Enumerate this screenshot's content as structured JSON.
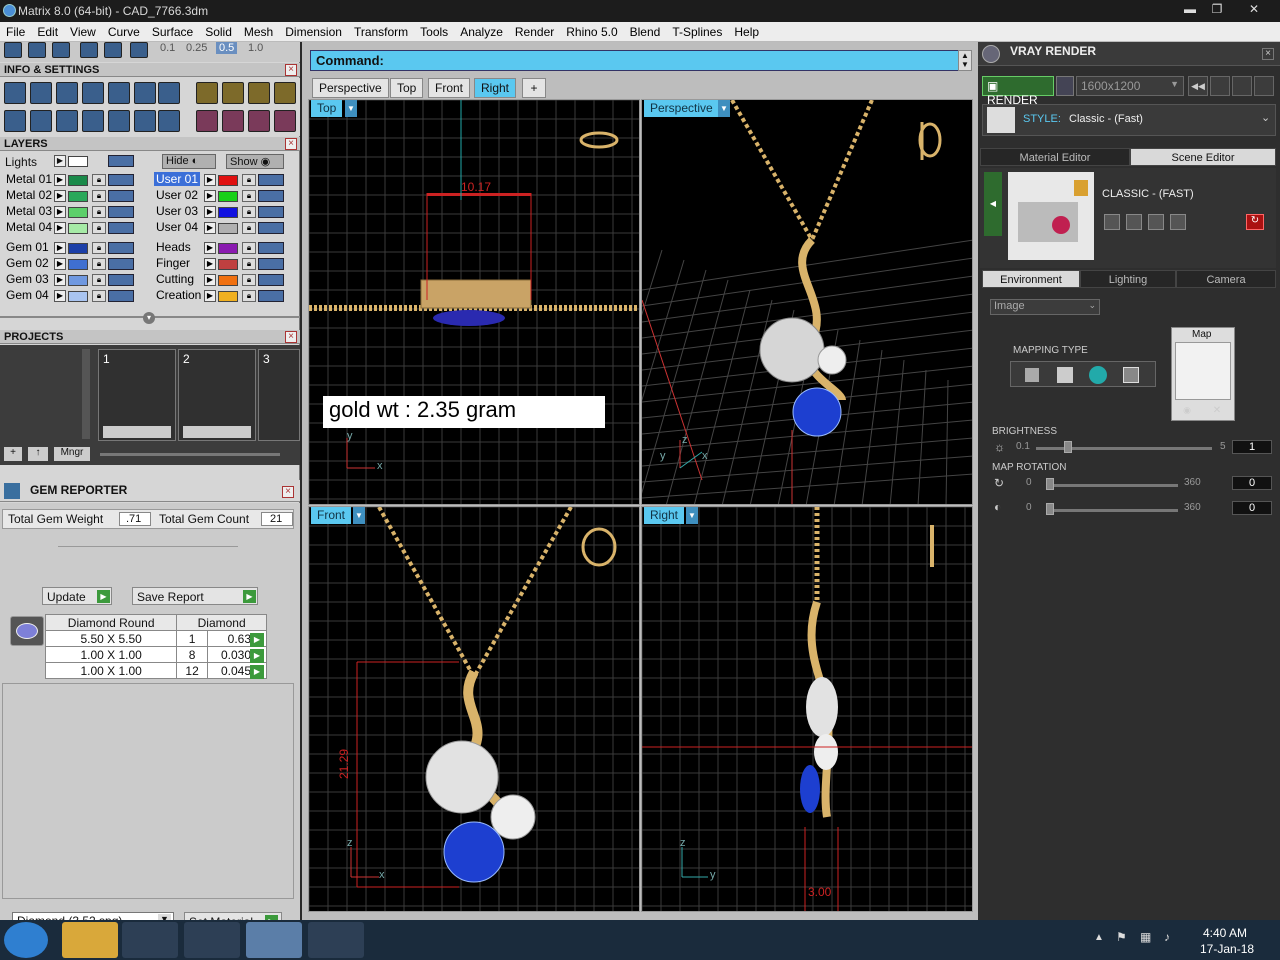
{
  "window": {
    "title": "Matrix 8.0 (64-bit) - CAD_7766.3dm",
    "min": "▬",
    "max": "❐",
    "close": "✕"
  },
  "menu": [
    "File",
    "Edit",
    "View",
    "Curve",
    "Surface",
    "Solid",
    "Mesh",
    "Dimension",
    "Transform",
    "Tools",
    "Analyze",
    "Render",
    "Rhino 5.0",
    "Blend",
    "T-Splines",
    "Help"
  ],
  "toolbar_top": {
    "values": [
      "0.1",
      "0.25",
      "0.5",
      "1.0"
    ]
  },
  "info_settings": {
    "title": "INFO & SETTINGS"
  },
  "layers": {
    "title": "LAYERS",
    "lights": "Lights",
    "hide": "Hide",
    "show": "Show",
    "left": [
      {
        "name": "Metal 01",
        "color": "#1a8a4a"
      },
      {
        "name": "Metal 02",
        "color": "#2aa85a"
      },
      {
        "name": "Metal 03",
        "color": "#5ccf6a"
      },
      {
        "name": "Metal 04",
        "color": "#a6eaa6"
      },
      {
        "name": "Gem 01",
        "color": "#1c3fa8"
      },
      {
        "name": "Gem 02",
        "color": "#3f6fd0"
      },
      {
        "name": "Gem 03",
        "color": "#6f98e0"
      },
      {
        "name": "Gem 04",
        "color": "#a9c4f0"
      }
    ],
    "right": [
      {
        "name": "User 01",
        "color": "#e01010"
      },
      {
        "name": "User 02",
        "color": "#18d018"
      },
      {
        "name": "User 03",
        "color": "#1010e0"
      },
      {
        "name": "User 04",
        "color": "#b0b0b0"
      },
      {
        "name": "Heads",
        "color": "#8a1ab0"
      },
      {
        "name": "Finger",
        "color": "#c04040"
      },
      {
        "name": "Cutting",
        "color": "#f07010"
      },
      {
        "name": "Creation",
        "color": "#f0b020"
      }
    ]
  },
  "projects": {
    "title": "PROJECTS",
    "slots": [
      "1",
      "2",
      "3"
    ],
    "mngr": "Mngr"
  },
  "gem_reporter": {
    "title": "GEM REPORTER",
    "total_weight_label": "Total Gem Weight",
    "total_weight": ".71",
    "total_count_label": "Total Gem Count",
    "total_count": "21",
    "update": "Update",
    "save_report": "Save Report",
    "headers": [
      "Diamond Round",
      "Diamond"
    ],
    "rows": [
      [
        "5.50 X 5.50",
        "1",
        "0.63tw"
      ],
      [
        "1.00 X 1.00",
        "8",
        "0.030tw"
      ],
      [
        "1.00 X 1.00",
        "12",
        "0.045tw"
      ]
    ],
    "material_select": "Diamond     (3.52 spg)",
    "set_material": "Set Material"
  },
  "command": {
    "label": "Command:"
  },
  "view_tabs": [
    "Perspective",
    "Top",
    "Front",
    "Right",
    "+"
  ],
  "active_view_tab": "Right",
  "viewports": {
    "top": {
      "label": "Top",
      "dim": "10.17",
      "note": "gold wt : 2.35 gram",
      "axes": [
        "y",
        "x"
      ]
    },
    "perspective": {
      "label": "Perspective",
      "axes": [
        "z",
        "y",
        "x"
      ]
    },
    "front": {
      "label": "Front",
      "dim": "21.29",
      "axes": [
        "z",
        "x"
      ]
    },
    "right": {
      "label": "Right",
      "dim": "3.00",
      "axes": [
        "z",
        "y"
      ]
    }
  },
  "vray": {
    "title": "VRAY RENDER",
    "render": "RENDER",
    "resolution": "1600x1200",
    "style_label": "STYLE:",
    "style_value": "Classic - (Fast)",
    "editor_tabs": [
      "Material Editor",
      "Scene Editor"
    ],
    "active_editor": "Scene Editor",
    "preset_name": "CLASSIC - (FAST)",
    "env_tabs": [
      "Environment",
      "Lighting",
      "Camera"
    ],
    "active_env": "Environment",
    "env_select": "Image",
    "mapping_type": "MAPPING TYPE",
    "map_label": "Map",
    "brightness": {
      "label": "BRIGHTNESS",
      "min": "0.1",
      "max": "5",
      "value": "1"
    },
    "map_rotation": {
      "label": "MAP ROTATION",
      "rows": [
        {
          "min": "0",
          "max": "360",
          "value": "0"
        },
        {
          "min": "0",
          "max": "360",
          "value": "0"
        }
      ]
    }
  },
  "taskbar": {
    "time": "4:40 AM",
    "date": "17-Jan-18"
  },
  "colors": {
    "accent": "#5ac8f0",
    "render_green": "#2e8b2e",
    "gold": "#d9b36a",
    "sapphire": "#1d3fd0"
  }
}
